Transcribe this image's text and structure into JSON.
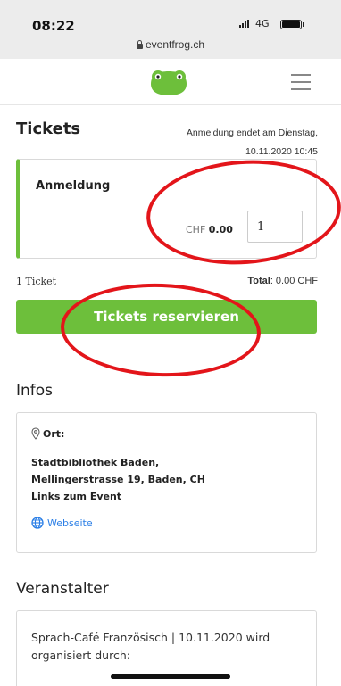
{
  "status_bar": {
    "time": "08:22",
    "network": "4G",
    "url": "eventfrog.ch"
  },
  "header": {
    "logo_icon": "frog-logo-icon",
    "menu_icon": "hamburger-menu-icon"
  },
  "tickets": {
    "title": "Tickets",
    "deadline_line1": "Anmeldung endet am Dienstag,",
    "deadline_line2": "10.11.2020 10:45",
    "item_name": "Anmeldung",
    "currency": "CHF",
    "price": "0.00",
    "quantity": "1",
    "count_label": "1 Ticket",
    "total_label": "Total",
    "total_value": ": 0.00 CHF",
    "reserve_button": "Tickets reservieren"
  },
  "infos": {
    "title": "Infos",
    "place_label": "Ort:",
    "address_line1": "Stadtbibliothek Baden,",
    "address_line2": "Mellingerstrasse 19, Baden, CH",
    "address_line3": "Links zum Event",
    "website_label": "Webseite"
  },
  "organizer": {
    "title": "Veranstalter",
    "text": "Sprach-Café Französisch | 10.11.2020 wird organisiert durch:"
  },
  "colors": {
    "accent": "#6dbf3b",
    "link": "#2a7ee6",
    "annotation": "#e3151a"
  }
}
